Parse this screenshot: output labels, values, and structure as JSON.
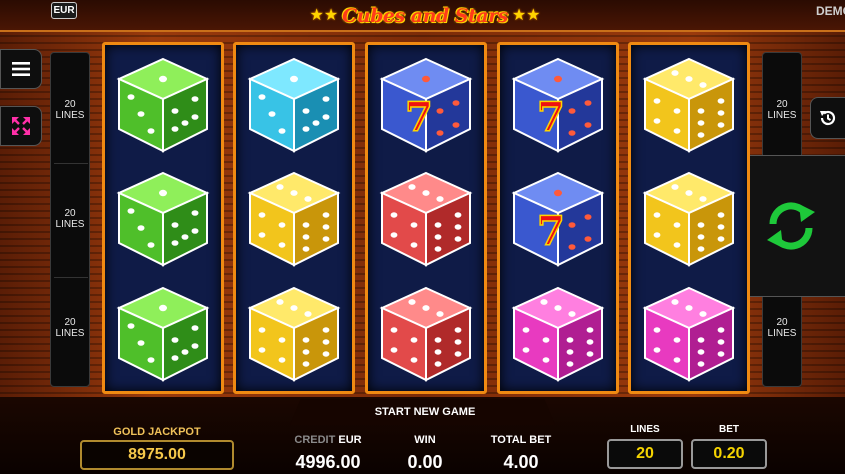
{
  "header": {
    "currency_badge": "EUR",
    "logo_title": "Cubes and Stars",
    "demo_label": "DEMO"
  },
  "line_indicators": {
    "left": [
      "20\nLINES",
      "20\nLINES",
      "20\nLINES"
    ],
    "right": [
      "20\nLINES",
      "20\nLINES"
    ]
  },
  "icons": {
    "menu": "hamburger-icon",
    "fullscreen": "fullscreen-arrows-icon",
    "history": "history-icon",
    "spin": "spin-arrows-icon"
  },
  "colors": {
    "reel_border": "#f08a12",
    "reel_bg": "#0f1b47",
    "spin_green": "#1ec93a",
    "jackpot_gold": "#f5c84a",
    "selector_yellow": "#f5d400"
  },
  "reels": [
    [
      {
        "color": "green",
        "face": "three"
      },
      {
        "color": "green",
        "face": "three"
      },
      {
        "color": "green",
        "face": "three"
      }
    ],
    [
      {
        "color": "cyan",
        "face": "three"
      },
      {
        "color": "yellow",
        "face": "six"
      },
      {
        "color": "yellow",
        "face": "six"
      }
    ],
    [
      {
        "color": "blue",
        "face": "seven"
      },
      {
        "color": "red",
        "face": "six"
      },
      {
        "color": "red",
        "face": "six"
      }
    ],
    [
      {
        "color": "blue",
        "face": "seven"
      },
      {
        "color": "blue",
        "face": "seven"
      },
      {
        "color": "magenta",
        "face": "six"
      }
    ],
    [
      {
        "color": "yellow",
        "face": "six"
      },
      {
        "color": "yellow",
        "face": "six"
      },
      {
        "color": "magenta",
        "face": "six"
      }
    ]
  ],
  "bottom": {
    "start_new_game": "START NEW GAME",
    "gold_jackpot_label": "GOLD JACKPOT",
    "gold_jackpot_value": "8975.00",
    "credit_label": "CREDIT",
    "credit_currency": "EUR",
    "credit_value": "4996.00",
    "win_label": "WIN",
    "win_value": "0.00",
    "total_bet_label": "TOTAL BET",
    "total_bet_value": "4.00",
    "lines_label": "LINES",
    "lines_value": "20",
    "bet_label": "BET",
    "bet_value": "0.20"
  }
}
